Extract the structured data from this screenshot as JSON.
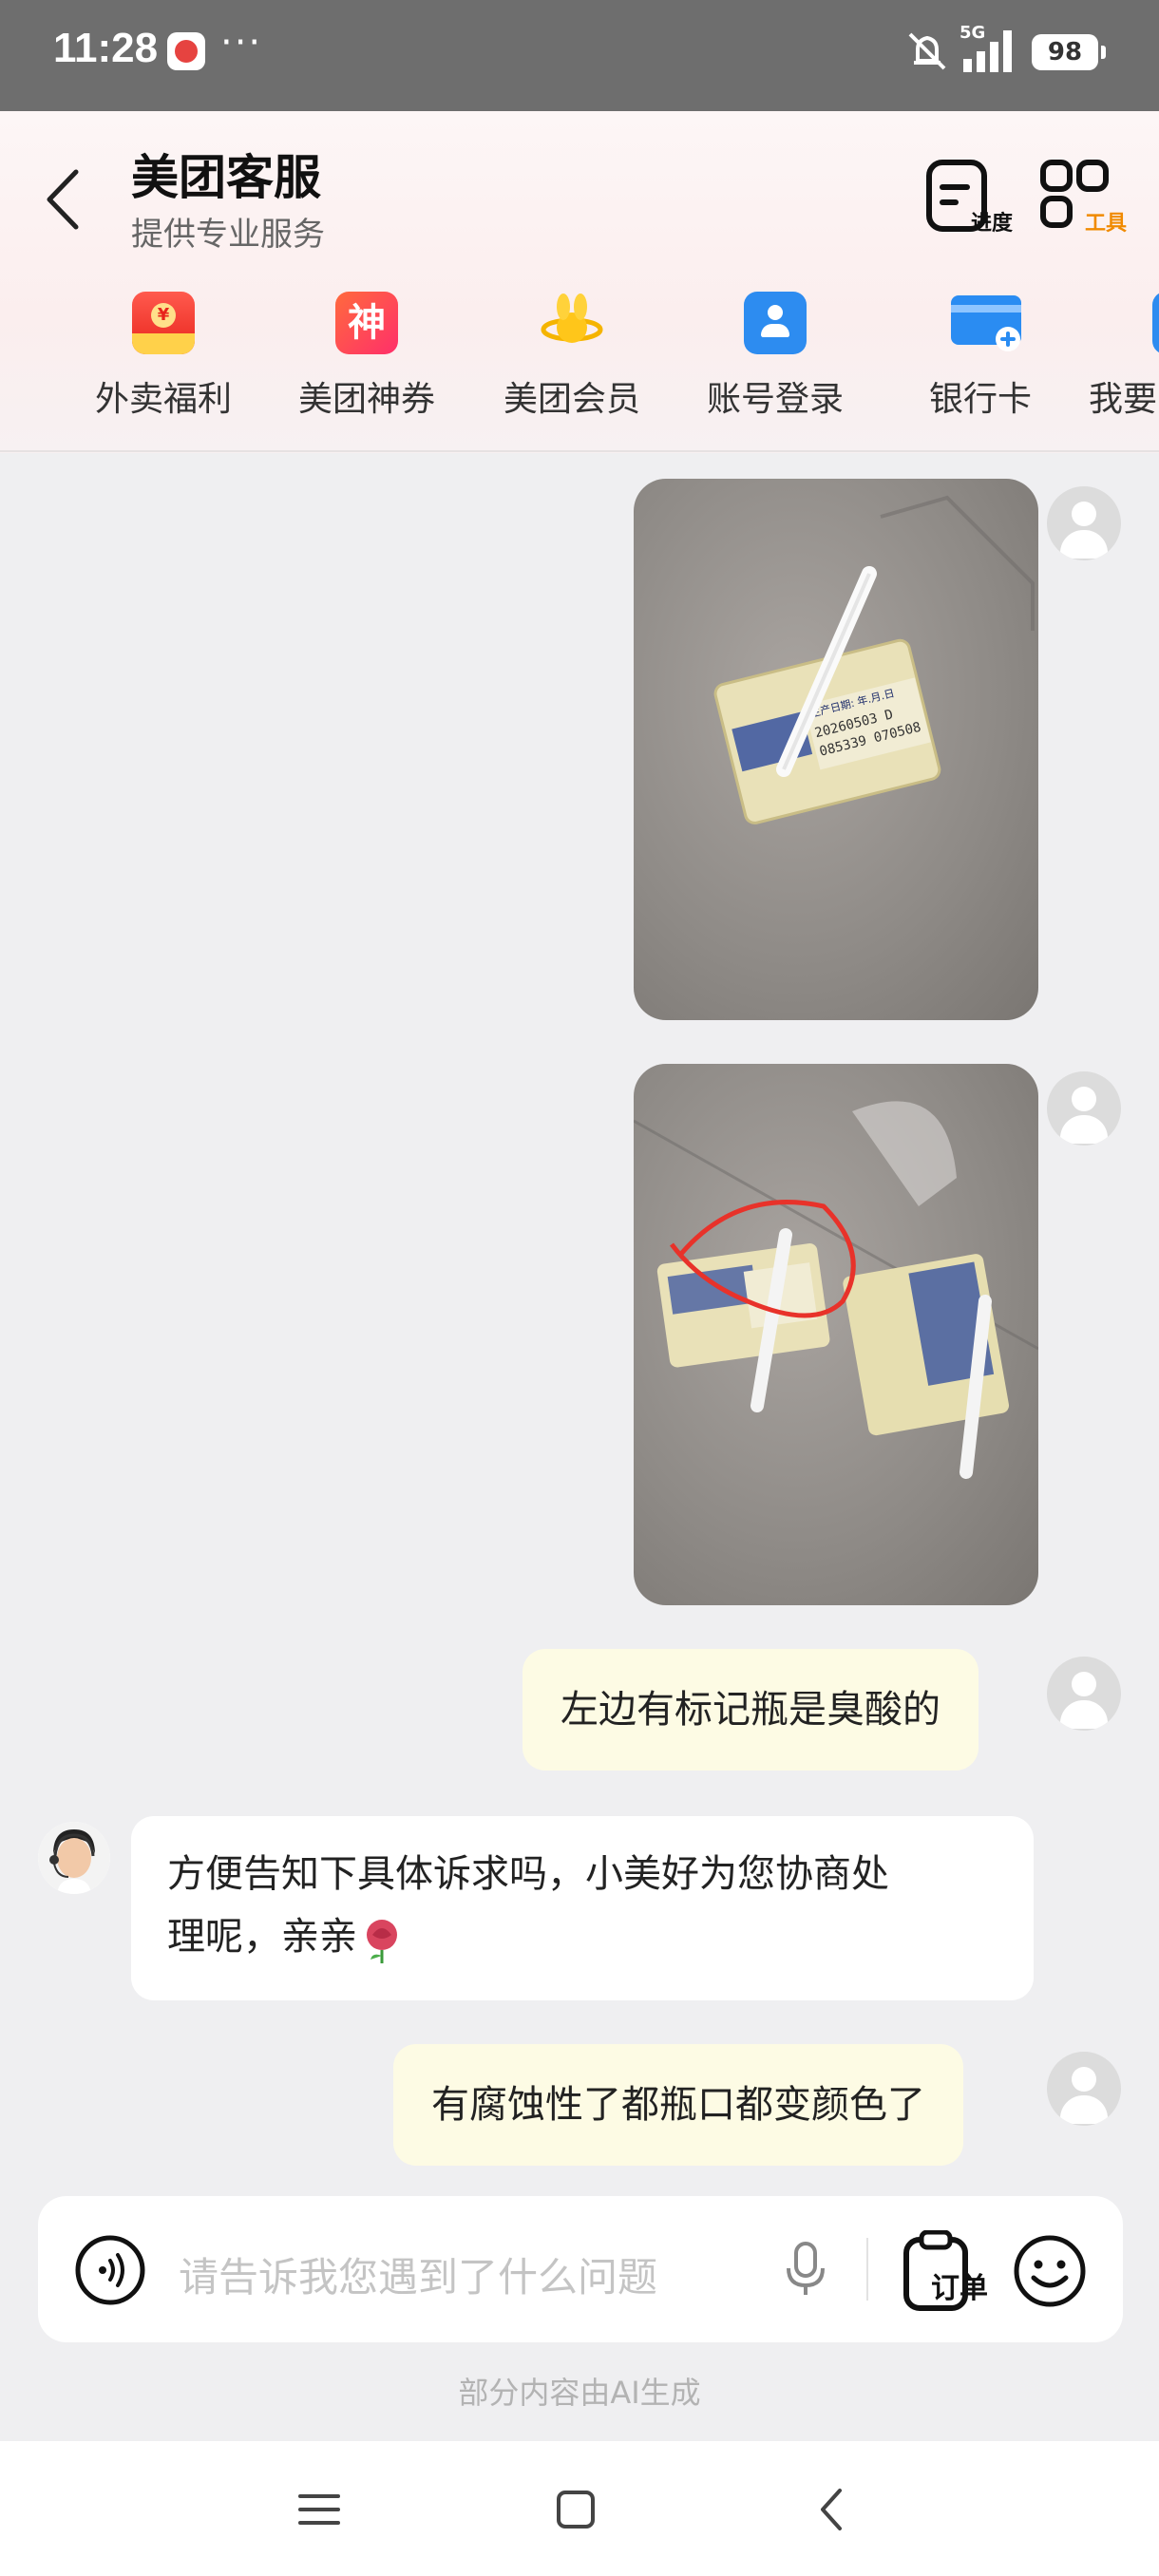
{
  "status_bar": {
    "time": "11:28",
    "overflow": "···",
    "network": "5G",
    "battery": "98"
  },
  "header": {
    "title": "美团客服",
    "subtitle": "提供专业服务",
    "tool_progress_label": "进度",
    "tool_tools_label": "工具"
  },
  "quick_actions": [
    {
      "label": "外卖福利",
      "icon": "red-envelope-icon"
    },
    {
      "label": "美团神券",
      "icon": "coupon-icon",
      "glyph": "神"
    },
    {
      "label": "美团会员",
      "icon": "member-icon"
    },
    {
      "label": "账号登录",
      "icon": "account-icon"
    },
    {
      "label": "银行卡",
      "icon": "bank-card-icon"
    },
    {
      "label": "我要",
      "icon": "more-icon"
    }
  ],
  "messages": [
    {
      "from": "user",
      "type": "image",
      "description": "photo-carton-1"
    },
    {
      "from": "user",
      "type": "image",
      "description": "photo-carton-2"
    },
    {
      "from": "user",
      "type": "text",
      "text": "左边有标记瓶是臭酸的"
    },
    {
      "from": "agent",
      "type": "text",
      "text_line1": "方便告知下具体诉求吗，小美好为您协商处",
      "text_line2": "理呢，亲亲"
    },
    {
      "from": "user",
      "type": "text",
      "text": "有腐蚀性了都瓶口都变颜色了"
    }
  ],
  "carton_labels": {
    "photo1_date_title": "生产日期: 年.月.日",
    "photo1_date": "20260503 D",
    "photo1_code": "085339 070508"
  },
  "input": {
    "placeholder": "请告诉我您遇到了什么问题",
    "order_label": "订单"
  },
  "footer_note": "部分内容由AI生成",
  "colors": {
    "header_bg": "#fbeeee",
    "user_bubble": "#fdfbe4",
    "agent_bubble": "#ffffff",
    "accent_orange": "#f08a00",
    "annotation_red": "#e8322a"
  }
}
